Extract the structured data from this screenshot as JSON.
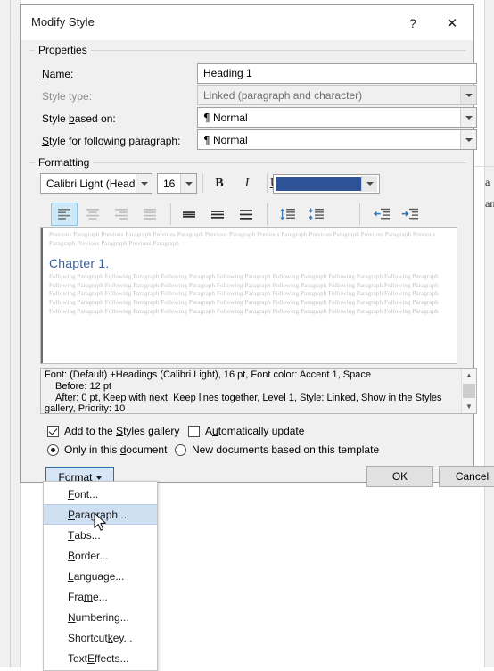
{
  "dialog": {
    "title": "Modify Style",
    "help_label": "?",
    "close_label": "✕"
  },
  "properties": {
    "group_title": "Properties",
    "fields": [
      {
        "label_pre": "",
        "label_key": "N",
        "label_post": "ame:",
        "value": "Heading 1",
        "type": "textbox",
        "disabled": false
      },
      {
        "label_pre": "",
        "label_key": "S",
        "label_post": "tyle type:",
        "value": "Linked (paragraph and character)",
        "type": "combo",
        "disabled": true
      },
      {
        "label_pre": "Style ",
        "label_key": "b",
        "label_post": "ased on:",
        "value": "Normal",
        "type": "combo",
        "disabled": false,
        "pilcrow": true
      },
      {
        "label_pre": "",
        "label_key": "S",
        "label_post": "tyle for following paragraph:",
        "value": "Normal",
        "type": "combo",
        "disabled": false,
        "pilcrow": true
      }
    ]
  },
  "formatting": {
    "group_title": "Formatting",
    "font_name": "Calibri Light (Head",
    "font_size": "16",
    "bold_label": "B",
    "italic_label": "I",
    "underline_label": "U",
    "font_color_hex": "#2E5396",
    "toolbar_row2": [
      {
        "name": "align-left-button",
        "state": "active"
      },
      {
        "name": "align-center-button",
        "state": "disabled"
      },
      {
        "name": "align-right-button",
        "state": "disabled"
      },
      {
        "name": "align-justify-button",
        "state": "disabled"
      },
      {
        "name": "line-spacing-single-button",
        "state": "normal"
      },
      {
        "name": "line-spacing-1half-button",
        "state": "normal"
      },
      {
        "name": "line-spacing-double-button",
        "state": "normal"
      },
      {
        "name": "increase-paragraph-spacing-button",
        "state": "normal"
      },
      {
        "name": "decrease-paragraph-spacing-button",
        "state": "normal"
      },
      {
        "name": "decrease-indent-button",
        "state": "normal"
      },
      {
        "name": "increase-indent-button",
        "state": "normal"
      }
    ]
  },
  "preview": {
    "previous_paragraph": "Previous Paragraph Previous Paragraph Previous Paragraph Previous Paragraph Previous Paragraph Previous Paragraph Previous Paragraph Previous Paragraph Previous Paragraph Previous Paragraph",
    "heading": "Chapter 1.",
    "following_paragraph": "Following Paragraph Following Paragraph Following Paragraph Following Paragraph Following Paragraph Following Paragraph Following Paragraph Following Paragraph Following Paragraph Following Paragraph Following Paragraph Following Paragraph Following Paragraph Following Paragraph Following Paragraph Following Paragraph Following Paragraph Following Paragraph Following Paragraph Following Paragraph Following Paragraph Following Paragraph Following Paragraph Following Paragraph Following Paragraph Following Paragraph Following Paragraph Following Paragraph Following Paragraph Following Paragraph Following Paragraph Following Paragraph Following Paragraph Following Paragraph Following Paragraph"
  },
  "description": {
    "line1": "Font: (Default) +Headings (Calibri Light), 16 pt, Font color: Accent 1, Space",
    "line2": "Before:  12 pt",
    "line3": "After:  0 pt, Keep with next, Keep lines together, Level 1, Style: Linked, Show in the Styles",
    "line4": "gallery, Priority: 10",
    "scroll_up": "▲",
    "scroll_down": "▼"
  },
  "options": {
    "add_to_gallery": {
      "label_pre": "Add to the ",
      "label_key": "S",
      "label_post": "tyles gallery",
      "checked": true
    },
    "auto_update": {
      "label_pre": "A",
      "label_key": "u",
      "label_post": "tomatically update",
      "checked": false
    },
    "only_this_doc": {
      "label_pre": "Only in this ",
      "label_key": "d",
      "label_post": "ocument",
      "checked": true
    },
    "new_docs_template": {
      "label_pre": "New documents based on this template",
      "label_key": "",
      "label_post": "",
      "checked": false
    }
  },
  "buttons": {
    "format": {
      "label_pre": "F",
      "label_key": "o",
      "label_post": "rmat"
    },
    "ok": "OK",
    "cancel": "Cancel"
  },
  "format_menu": {
    "items": [
      {
        "pre": "",
        "key": "F",
        "post": "ont...",
        "highlighted": false
      },
      {
        "pre": "",
        "key": "P",
        "post": "aragraph...",
        "highlighted": true
      },
      {
        "pre": "",
        "key": "T",
        "post": "abs...",
        "highlighted": false
      },
      {
        "pre": "",
        "key": "B",
        "post": "order...",
        "highlighted": false
      },
      {
        "pre": "",
        "key": "L",
        "post": "anguage...",
        "highlighted": false
      },
      {
        "pre": "Fra",
        "key": "m",
        "post": "e...",
        "highlighted": false
      },
      {
        "pre": "",
        "key": "N",
        "post": "umbering...",
        "highlighted": false
      },
      {
        "pre": "Shortcut ",
        "key": "k",
        "post": "ey...",
        "highlighted": false
      },
      {
        "pre": "Text ",
        "key": "E",
        "post": "ffects...",
        "highlighted": false
      }
    ]
  },
  "background": {
    "text_fragment_1": "a",
    "text_fragment_2": "an"
  }
}
